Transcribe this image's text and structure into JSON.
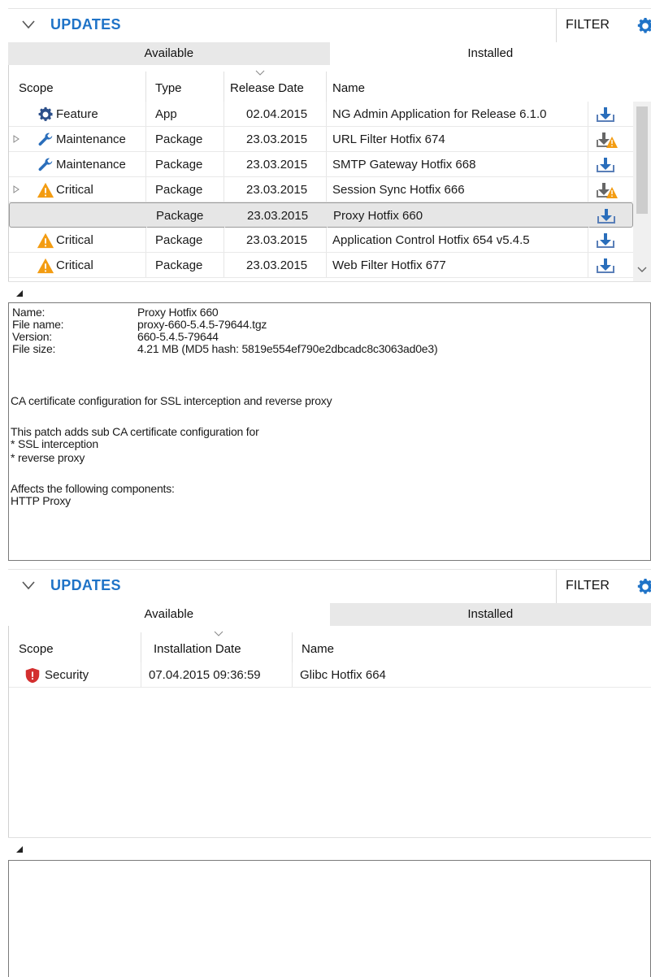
{
  "available_panel": {
    "title": "UPDATES",
    "filter_label": "FILTER",
    "tabs": [
      "Available",
      "Installed"
    ],
    "columns": [
      "Scope",
      "Type",
      "Release Date",
      "Name"
    ],
    "rows": [
      {
        "scope": "Feature",
        "scope_icon": "gear-icon",
        "expandable": false,
        "type": "App",
        "date": "02.04.2015",
        "name": "NG Admin Application for Release 6.1.0",
        "action_icon": "download-icon"
      },
      {
        "scope": "Maintenance",
        "scope_icon": "wrench-icon",
        "expandable": true,
        "type": "Package",
        "date": "23.03.2015",
        "name": "URL Filter Hotfix 674",
        "action_icon": "download-warning-icon"
      },
      {
        "scope": "Maintenance",
        "scope_icon": "wrench-icon",
        "expandable": false,
        "type": "Package",
        "date": "23.03.2015",
        "name": "SMTP Gateway Hotfix 668",
        "action_icon": "download-icon"
      },
      {
        "scope": "Critical",
        "scope_icon": "warning-icon",
        "expandable": true,
        "type": "Package",
        "date": "23.03.2015",
        "name": "Session Sync Hotfix 666",
        "action_icon": "download-warning-icon"
      },
      {
        "scope": "",
        "scope_icon": "",
        "expandable": false,
        "selected": true,
        "type": "Package",
        "date": "23.03.2015",
        "name": "Proxy Hotfix 660",
        "action_icon": "download-icon"
      },
      {
        "scope": "Critical",
        "scope_icon": "warning-icon",
        "expandable": false,
        "type": "Package",
        "date": "23.03.2015",
        "name": "Application Control Hotfix 654 v5.4.5",
        "action_icon": "download-icon"
      },
      {
        "scope": "Critical",
        "scope_icon": "warning-icon",
        "expandable": false,
        "type": "Package",
        "date": "23.03.2015",
        "name": "Web Filter Hotfix 677",
        "action_icon": "download-icon"
      }
    ],
    "details": {
      "fields": [
        {
          "key": "Name:",
          "value": "Proxy Hotfix 660"
        },
        {
          "key": "File name:",
          "value": "proxy-660-5.4.5-79644.tgz"
        },
        {
          "key": "Version:",
          "value": "660-5.4.5-79644"
        },
        {
          "key": "File size:",
          "value": "4.21 MB  (MD5 hash: 5819e554ef790e2dbcadc8c3063ad0e3)"
        }
      ],
      "summary": "CA certificate configuration for SSL interception and reverse proxy",
      "intro": "This patch adds sub CA certificate configuration for",
      "bullets": [
        "* SSL interception",
        "* reverse proxy"
      ],
      "affects_label": "Affects the following components:",
      "affects_value": "HTTP Proxy"
    }
  },
  "installed_panel": {
    "title": "UPDATES",
    "filter_label": "FILTER",
    "tabs": [
      "Available",
      "Installed"
    ],
    "columns": [
      "Scope",
      "Installation Date",
      "Name"
    ],
    "rows": [
      {
        "scope": "Security",
        "scope_icon": "shield-icon",
        "date": "07.04.2015 09:36:59",
        "name": "Glibc Hotfix 664"
      }
    ]
  },
  "colors": {
    "accent_blue": "#1f73c7",
    "warning_orange": "#f39c12",
    "security_red": "#d32f2f",
    "download_blue": "#2a6ebb"
  }
}
